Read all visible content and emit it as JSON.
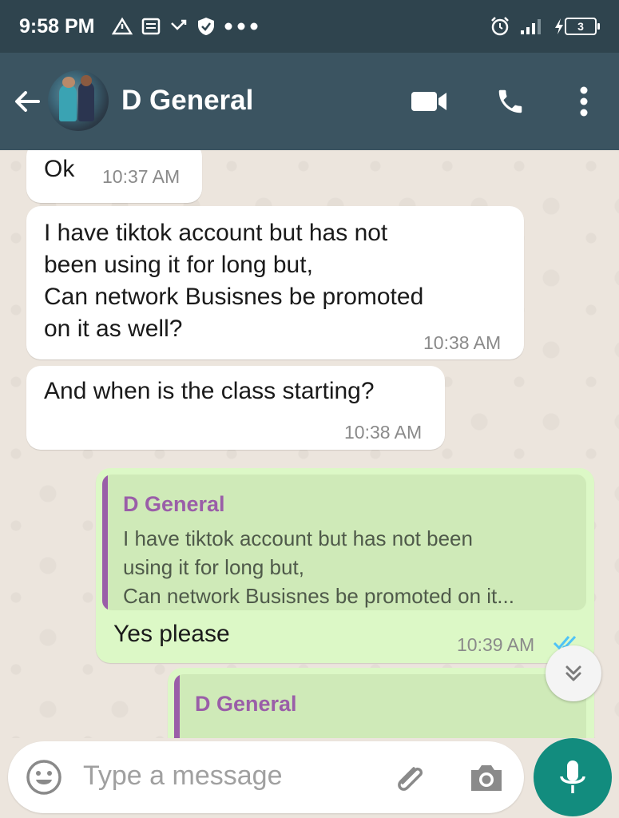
{
  "status_bar": {
    "time": "9:58 PM",
    "battery": "3"
  },
  "header": {
    "contact_name": "D General"
  },
  "messages": [
    {
      "direction": "in",
      "lines": [
        "Ok"
      ],
      "time": "10:37 AM"
    },
    {
      "direction": "in",
      "lines": [
        "I have tiktok account but has not",
        "been using it for long but,",
        "Can network Busisnes be promoted",
        "on it as well?"
      ],
      "time": "10:38 AM"
    },
    {
      "direction": "in",
      "lines": [
        "And when is the class starting?"
      ],
      "time": "10:38 AM"
    },
    {
      "direction": "out",
      "quote": {
        "name": "D General",
        "lines": [
          "I have tiktok account but has not been",
          "using it for long but,",
          "Can network Busisnes be promoted on it..."
        ]
      },
      "text": "Yes please",
      "time": "10:39 AM",
      "status": "read"
    },
    {
      "direction": "out",
      "quote": {
        "name": "D General"
      }
    }
  ],
  "composer": {
    "placeholder": "Type a message"
  },
  "icons": {
    "status": [
      "alert-triangle-icon",
      "news-icon",
      "missed-call-icon",
      "shield-check-icon",
      "more-dots-icon",
      "alarm-icon",
      "signal-icon",
      "charging-icon",
      "battery-icon"
    ],
    "header": [
      "back-arrow-icon",
      "video-call-icon",
      "phone-icon",
      "overflow-menu-icon"
    ],
    "composer": [
      "emoji-icon",
      "attach-icon",
      "camera-icon",
      "mic-icon"
    ]
  },
  "colors": {
    "header": "#3b5461",
    "status_bar": "#2f444e",
    "outgoing_bubble": "#dcf8c6",
    "quote_accent": "#9a5ea8",
    "mic_button": "#128c7e",
    "read_ticks": "#4fc3f7"
  }
}
